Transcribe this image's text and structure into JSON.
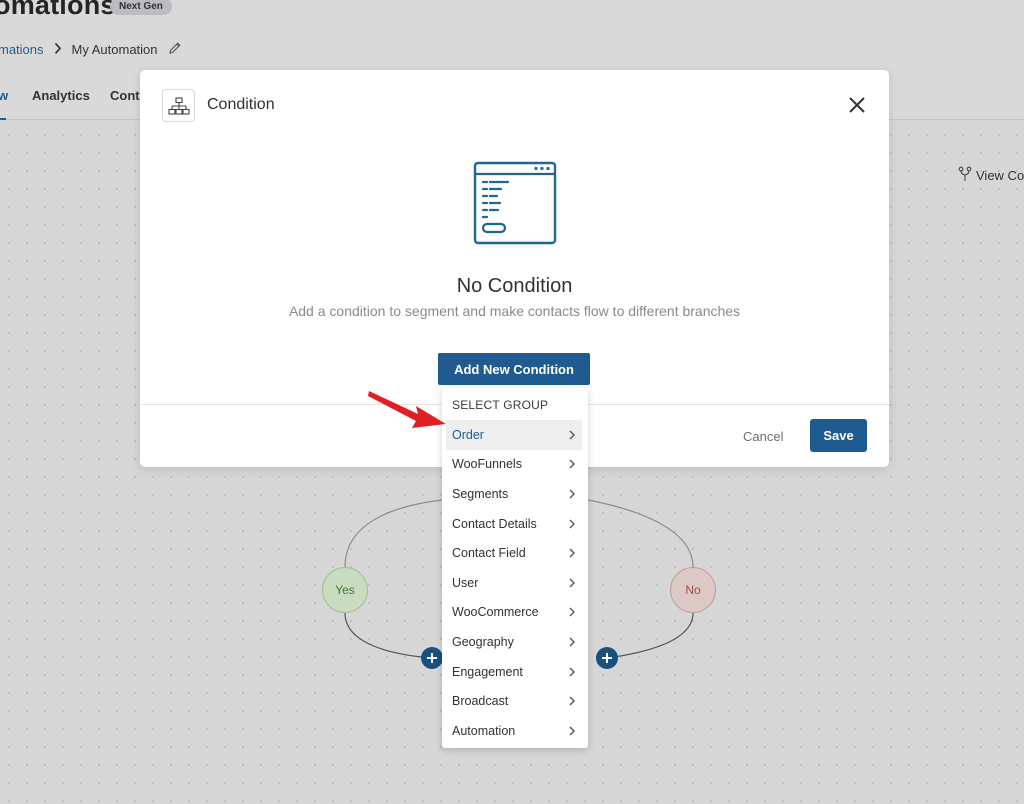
{
  "app": {
    "title": "omations",
    "badge": "Next Gen",
    "breadcrumb": {
      "parent": "mations",
      "current": "My Automation"
    },
    "tabs": {
      "active_fragment": "w",
      "analytics": "Analytics",
      "contacts": "Conta"
    },
    "view_contacts": "View Cor"
  },
  "workflow": {
    "yes_label": "Yes",
    "no_label": "No"
  },
  "modal": {
    "title": "Condition",
    "empty_title": "No Condition",
    "empty_subtitle": "Add a condition to segment and make contacts flow to different branches",
    "add_button": "Add New Condition",
    "cancel_button": "Cancel",
    "save_button": "Save"
  },
  "dropdown": {
    "header": "SELECT GROUP",
    "items": [
      {
        "label": "Order",
        "active": true
      },
      {
        "label": "WooFunnels"
      },
      {
        "label": "Segments"
      },
      {
        "label": "Contact Details"
      },
      {
        "label": "Contact Field"
      },
      {
        "label": "User"
      },
      {
        "label": "WooCommerce"
      },
      {
        "label": "Geography"
      },
      {
        "label": "Engagement"
      },
      {
        "label": "Broadcast"
      },
      {
        "label": "Automation"
      }
    ]
  },
  "colors": {
    "primary": "#1f5b90",
    "arrow": "#e02020",
    "yes_node": "#c9dcc2",
    "no_node": "#dcc9c5"
  }
}
